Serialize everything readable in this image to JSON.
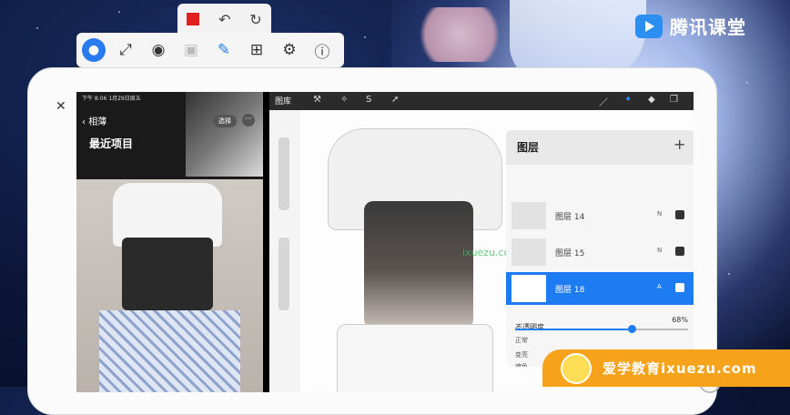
{
  "branding": {
    "name": "腾讯课堂"
  },
  "recorder": {
    "top_icons": [
      "stop-icon",
      "undo-icon",
      "redo-icon"
    ],
    "toolbar_icons": [
      "avatar-icon",
      "fullscreen-icon",
      "camera-icon",
      "video-icon",
      "pen-icon",
      "gift-icon",
      "settings-icon",
      "help-icon"
    ]
  },
  "photos": {
    "status": "下午 8:06 1月29日周五",
    "back_label": "相薄",
    "select_label": "选择",
    "more_label": "···",
    "section_title": "最近项目"
  },
  "procreate": {
    "gallery_label": "图库",
    "watermark": "ixuezu.com",
    "layers_panel": {
      "title": "图层",
      "add_label": "+",
      "layers": [
        {
          "name": "图层 14",
          "mode": "N",
          "active": false
        },
        {
          "name": "图层 15",
          "mode": "N",
          "active": false
        },
        {
          "name": "图层 18",
          "mode": "A",
          "active": true
        }
      ],
      "opacity_label": "不透明度",
      "opacity_value": "68%",
      "opacity_fraction": 0.68,
      "blend_modes": [
        "正常",
        "变亮",
        "遮色"
      ]
    }
  },
  "badge": {
    "text": "爱学教育ixuezu.com"
  },
  "colors": {
    "accent": "#1e7cf2",
    "record": "#e02020",
    "badge": "#f6a21a"
  }
}
